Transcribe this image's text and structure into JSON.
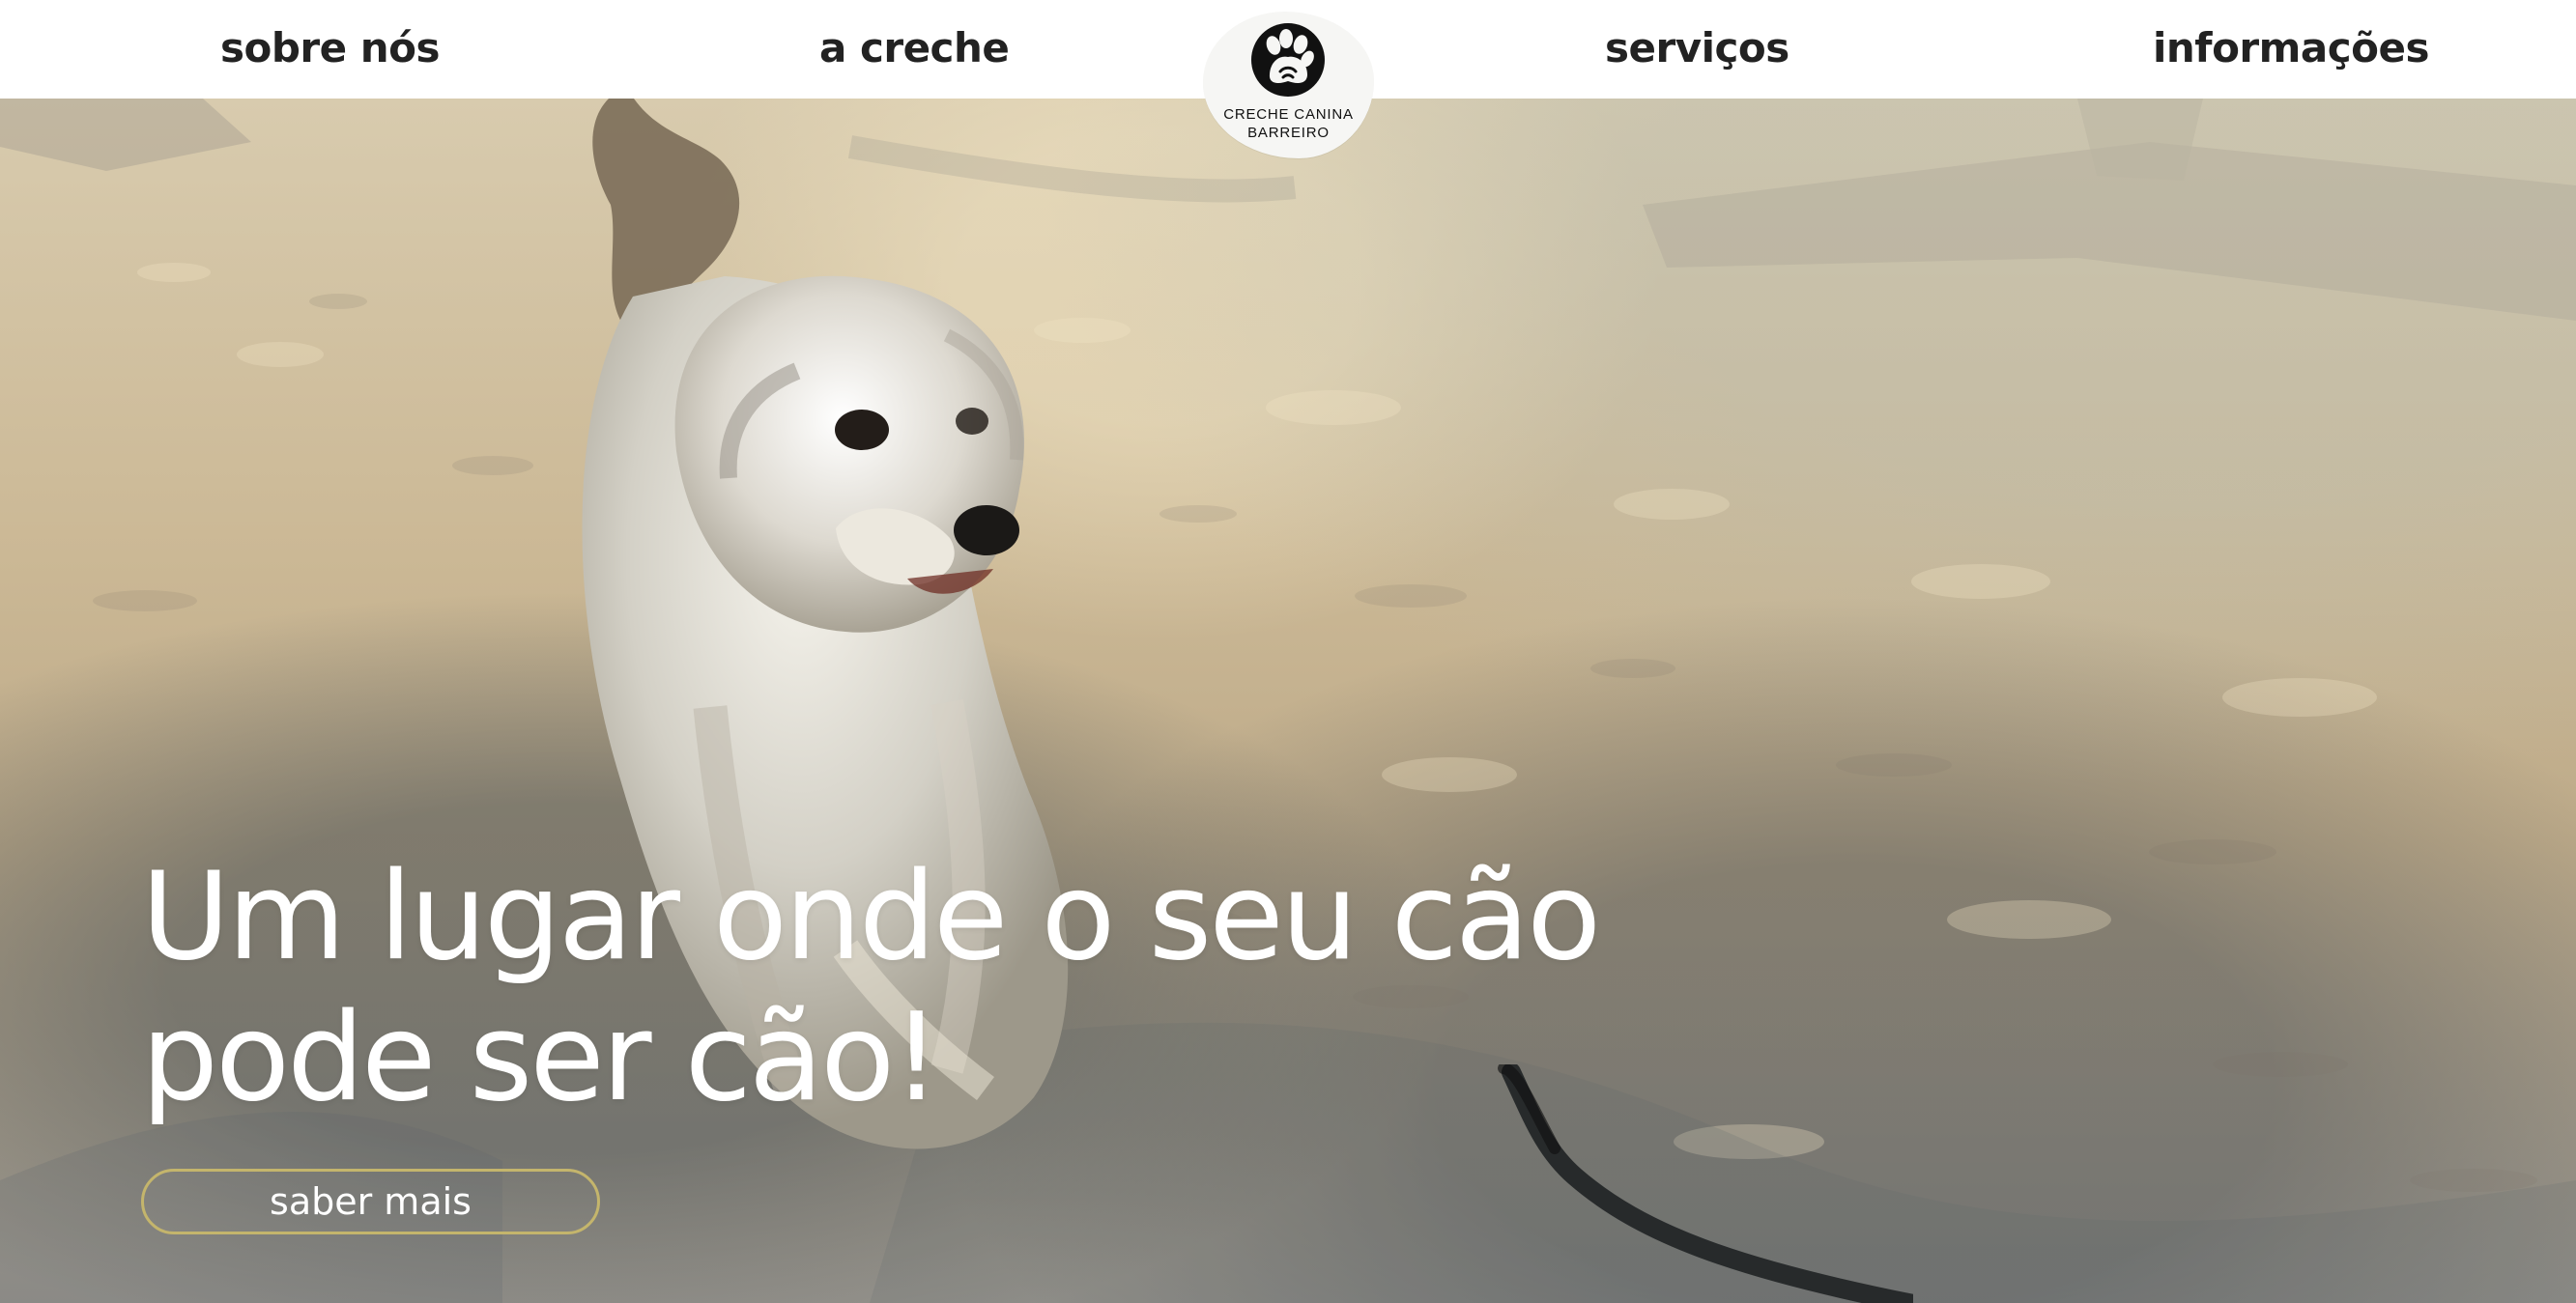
{
  "navigation": {
    "items": [
      {
        "label": "sobre nós"
      },
      {
        "label": "a creche"
      },
      {
        "label": "serviços"
      },
      {
        "label": "informações"
      }
    ]
  },
  "brand": {
    "line1": "CRECHE CANINA",
    "line2": "BARREIRO",
    "logo_icon": "paw-icon"
  },
  "hero": {
    "headline_line1": "Um lugar onde o seu cão",
    "headline_line2": "pode ser cão!",
    "cta_label": "saber mais",
    "image_subject": "dog-running-on-sand"
  },
  "colors": {
    "header_background": "#ffffff",
    "nav_text": "#222222",
    "headline_text": "#ffffff",
    "button_border": "#c4b56c"
  }
}
